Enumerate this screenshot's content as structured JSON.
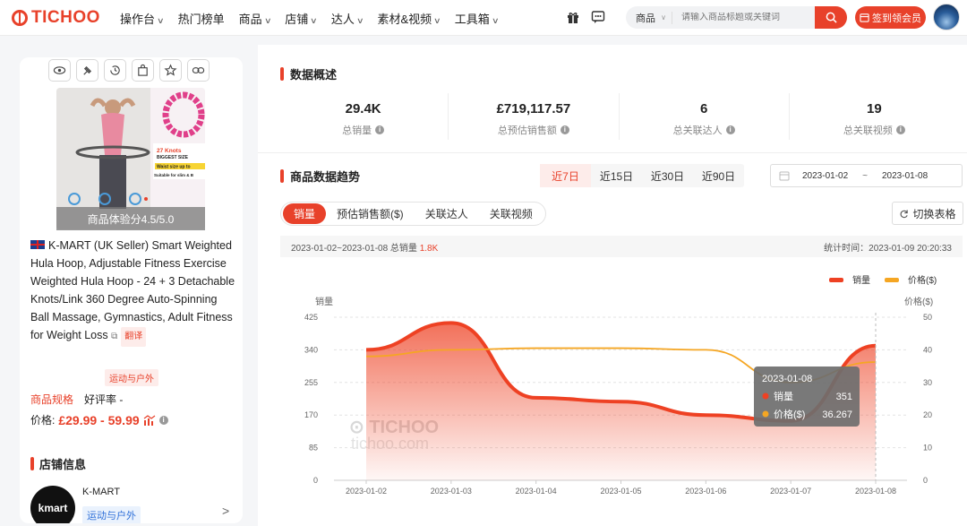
{
  "app": {
    "brand": "TICHOO",
    "accent": "#e8412a"
  },
  "nav": {
    "items": [
      "操作台",
      "热门榜单",
      "商品",
      "店铺",
      "达人",
      "素材&视频",
      "工具箱"
    ],
    "has_dropdown": [
      true,
      false,
      true,
      true,
      true,
      true,
      true
    ]
  },
  "search": {
    "category": "商品",
    "placeholder": "请输入商品标题或关键词"
  },
  "vip_button": "签到领会员",
  "product": {
    "score": "商品体验分4.5/5.0",
    "title": "K-MART (UK Seller) Smart Weighted Hula Hoop, Adjustable Fitness Exercise Weighted Hula Hoop - 24 + 3 Detachable Knots/Link 360 Degree Auto-Spinning Ball Massage, Gymnastics, Adult Fitness for Weight Loss",
    "translate": "翻译",
    "category_tag": "运动与户外",
    "spec_link": "商品规格",
    "rating": "好评率 -",
    "price_label": "价格:",
    "price": "£29.99 - 59.99",
    "image_text": {
      "line1": "27 Knots",
      "line2": "BIGGEST SIZE",
      "line3": "Waist size up to",
      "line4": "Suitable for slim & B"
    }
  },
  "shop": {
    "header": "店铺信息",
    "logo": "kmart",
    "name": "K-MART",
    "tag": "运动与户外"
  },
  "overview": {
    "title": "数据概述",
    "stats": [
      {
        "value": "29.4K",
        "label": "总销量"
      },
      {
        "value": "£719,117.57",
        "label": "总预估销售额"
      },
      {
        "value": "6",
        "label": "总关联达人"
      },
      {
        "value": "19",
        "label": "总关联视频"
      }
    ]
  },
  "trend": {
    "title": "商品数据趋势",
    "ranges": [
      "近7日",
      "近15日",
      "近30日",
      "近90日"
    ],
    "active_range": 0,
    "date_from": "2023-01-02",
    "date_sep": "~",
    "date_to": "2023-01-08",
    "metric_tabs": [
      "销量",
      "预估销售额($)",
      "关联达人",
      "关联视频"
    ],
    "active_metric": 0,
    "switch_label": "切换表格",
    "info_left": "2023-01-02~2023-01-08 总销量",
    "info_total": "1.8K",
    "info_right": "统计时间：2023-01-09 20:20:33"
  },
  "chart_data": {
    "type": "line",
    "x": [
      "2023-01-02",
      "2023-01-03",
      "2023-01-04",
      "2023-01-05",
      "2023-01-06",
      "2023-01-07",
      "2023-01-08"
    ],
    "series": [
      {
        "name": "销量",
        "axis": "left",
        "color": "#ee4123",
        "area": true,
        "values": [
          340,
          410,
          215,
          205,
          170,
          155,
          351
        ]
      },
      {
        "name": "价格($)",
        "axis": "right",
        "color": "#f5a623",
        "area": false,
        "values": [
          38,
          40,
          40.5,
          40.5,
          40,
          30,
          36.267
        ]
      }
    ],
    "ylabel": "销量",
    "y2label": "价格($)",
    "yticks": [
      0,
      85,
      170,
      255,
      340,
      425
    ],
    "y2ticks": [
      0,
      10,
      20,
      30,
      40,
      50
    ],
    "ylim": [
      0,
      425
    ],
    "y2lim": [
      0,
      50
    ],
    "legend": "top-right",
    "grid": true,
    "watermark": "TICHOO",
    "watermark_sub": "tichoo.com",
    "tooltip": {
      "date": "2023-01-08",
      "rows": [
        {
          "label": "销量",
          "value": "351"
        },
        {
          "label": "价格($)",
          "value": "36.267"
        }
      ]
    }
  }
}
